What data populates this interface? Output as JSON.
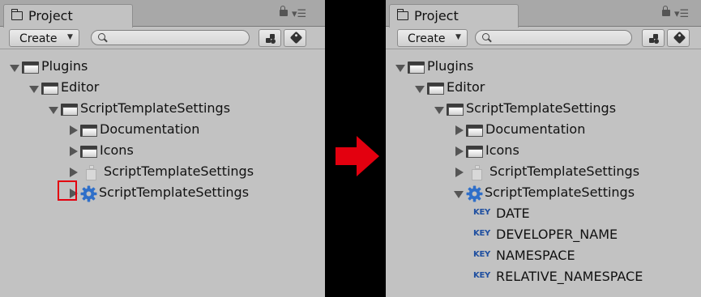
{
  "left": {
    "tab_title": "Project",
    "create_label": "Create",
    "tree": [
      {
        "label": "Plugins",
        "icon": "folder-icon",
        "arrow": "open"
      },
      {
        "label": "Editor",
        "icon": "folder-icon",
        "arrow": "open"
      },
      {
        "label": "ScriptTemplateSettings",
        "icon": "folder-icon",
        "arrow": "open"
      },
      {
        "label": "Documentation",
        "icon": "folder-icon",
        "arrow": "closed"
      },
      {
        "label": "Icons",
        "icon": "folder-icon",
        "arrow": "closed"
      },
      {
        "label": "ScriptTemplateSettings",
        "icon": "script-icon",
        "arrow": "closed"
      },
      {
        "label": "ScriptTemplateSettings",
        "icon": "gear-icon",
        "arrow": "closed"
      }
    ]
  },
  "right": {
    "tab_title": "Project",
    "create_label": "Create",
    "tree": [
      {
        "label": "Plugins",
        "icon": "folder-icon",
        "arrow": "open"
      },
      {
        "label": "Editor",
        "icon": "folder-icon",
        "arrow": "open"
      },
      {
        "label": "ScriptTemplateSettings",
        "icon": "folder-icon",
        "arrow": "open"
      },
      {
        "label": "Documentation",
        "icon": "folder-icon",
        "arrow": "closed"
      },
      {
        "label": "Icons",
        "icon": "folder-icon",
        "arrow": "closed"
      },
      {
        "label": "ScriptTemplateSettings",
        "icon": "script-icon",
        "arrow": "closed"
      },
      {
        "label": "ScriptTemplateSettings",
        "icon": "gear-icon",
        "arrow": "open"
      },
      {
        "label": "DATE",
        "icon": "key-icon"
      },
      {
        "label": "DEVELOPER_NAME",
        "icon": "key-icon"
      },
      {
        "label": "NAMESPACE",
        "icon": "key-icon"
      },
      {
        "label": "RELATIVE_NAMESPACE",
        "icon": "key-icon"
      }
    ]
  },
  "key_badge": "KEY",
  "colors": {
    "panel_bg": "#c2c2c2",
    "divider": "#000000",
    "highlight": "#e3000f",
    "key_blue": "#1f4fa0",
    "gear_blue": "#2f6fc9"
  }
}
